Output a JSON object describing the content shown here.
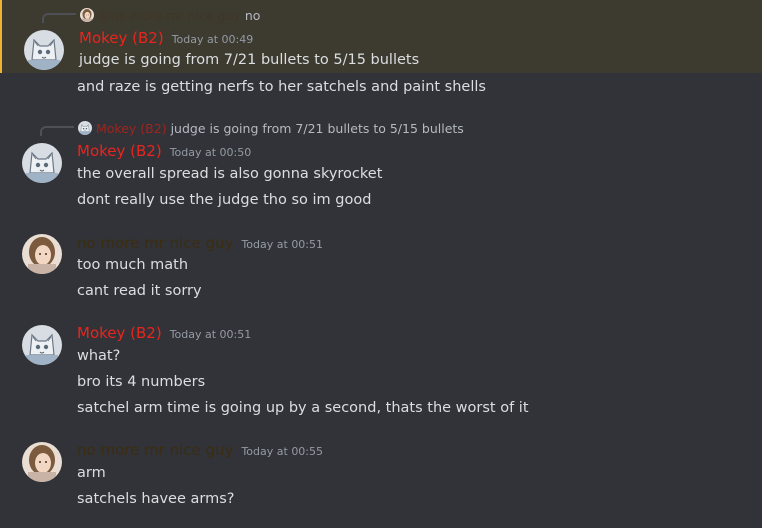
{
  "colors": {
    "background": "#313338",
    "highlight_bg": "#3d3a30",
    "highlight_border": "#f0b232",
    "mokey_name": "#e8251e",
    "nice_guy_name": "#3a2d12",
    "nice_guy_reply_name": "#3f3626",
    "text": "#dbdee1",
    "timestamp": "#949ba4"
  },
  "messages": [
    {
      "reply": {
        "author": "@no more mr nice guy",
        "text": "no"
      },
      "author": "Mokey (B2)",
      "timestamp": "Today at 00:49",
      "lines": [
        "judge is going from 7/21 bullets to 5/15 bullets",
        "and raze is getting nerfs to her satchels and paint shells"
      ]
    },
    {
      "reply": {
        "author": "Mokey (B2)",
        "text": "judge is going from 7/21 bullets to 5/15 bullets"
      },
      "author": "Mokey (B2)",
      "timestamp": "Today at 00:50",
      "lines": [
        "the overall spread is also gonna skyrocket",
        "dont really use the judge tho so im good"
      ]
    },
    {
      "author": "no more mr nice guy",
      "timestamp": "Today at 00:51",
      "lines": [
        "too much math",
        "cant read it  sorry"
      ]
    },
    {
      "author": "Mokey (B2)",
      "timestamp": "Today at 00:51",
      "lines": [
        "what?",
        "bro its 4 numbers",
        "satchel arm time is going up by a second, thats the worst of it"
      ]
    },
    {
      "author": "no more mr nice guy",
      "timestamp": "Today at 00:55",
      "lines": [
        "arm",
        "satchels havee arms?"
      ]
    }
  ]
}
